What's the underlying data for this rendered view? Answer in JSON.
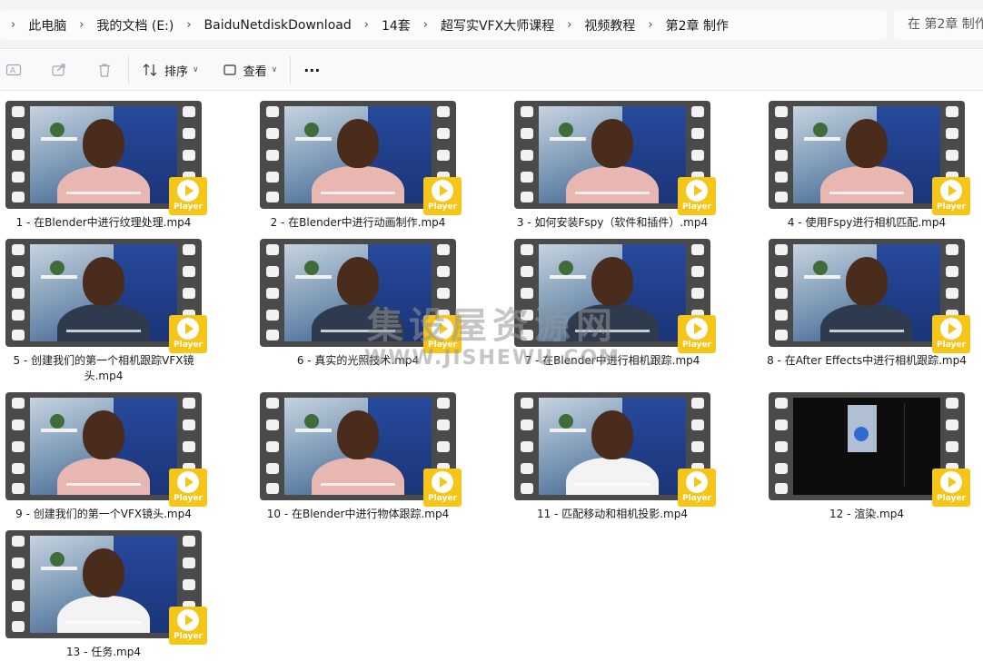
{
  "breadcrumb": [
    "此电脑",
    "我的文档 (E:)",
    "BaiduNetdiskDownload",
    "14套",
    "超写实VFX大师课程",
    "视频教程",
    "第2章  制作"
  ],
  "search": {
    "placeholder": "在 第2章  制作"
  },
  "toolbar": {
    "sort_label": "排序",
    "view_label": "查看",
    "more_label": "···"
  },
  "colors": {
    "player_badge": "#f5c518",
    "film_strip": "#4a4a4a"
  },
  "player_badge_text": "Player",
  "files": [
    {
      "name": "1 - 在Blender中进行纹理处理.mp4",
      "scene": "pink"
    },
    {
      "name": "2 - 在Blender中进行动画制作.mp4",
      "scene": "pink"
    },
    {
      "name": "3 - 如何安装Fspy（软件和插件）.mp4",
      "scene": "pink"
    },
    {
      "name": "4 - 使用Fspy进行相机匹配.mp4",
      "scene": "pink"
    },
    {
      "name": "5 - 创建我们的第一个相机跟踪VFX镜头.mp4",
      "scene": "dark"
    },
    {
      "name": "6 - 真实的光照技术.mp4",
      "scene": "dark"
    },
    {
      "name": "7 - 在Blender中进行相机跟踪.mp4",
      "scene": "dark"
    },
    {
      "name": "8 - 在After Effects中进行相机跟踪.mp4",
      "scene": "dark"
    },
    {
      "name": "9 - 创建我们的第一个VFX镜头.mp4",
      "scene": "pink"
    },
    {
      "name": "10 - 在Blender中进行物体跟踪.mp4",
      "scene": "pink"
    },
    {
      "name": "11 - 匹配移动和相机投影.mp4",
      "scene": "white"
    },
    {
      "name": "12 - 渲染.mp4",
      "scene": "black"
    },
    {
      "name": "13 - 任务.mp4",
      "scene": "white"
    }
  ],
  "watermark": {
    "cn": "集设屋资源网",
    "en": "WWW.JISHEWU.COM"
  }
}
